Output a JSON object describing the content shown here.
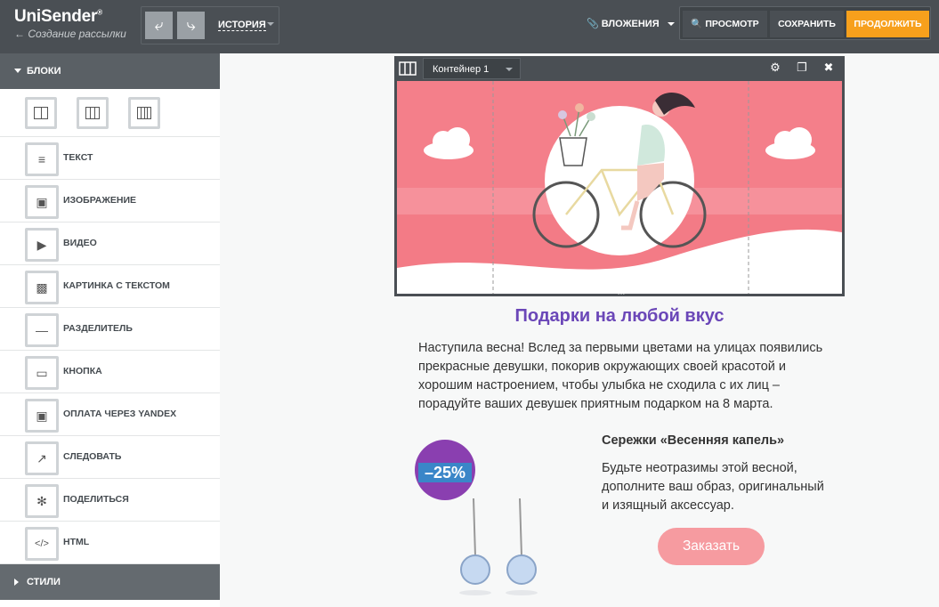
{
  "app": {
    "logo": "UniSender",
    "logo_mark": "®",
    "back_link": "← Создание рассылки"
  },
  "toolbar": {
    "history_label": "ИСТОРИЯ",
    "attachments_label": "ВЛОЖЕНИЯ",
    "preview_label": "ПРОСМОТР",
    "save_label": "СОХРАНИТЬ",
    "continue_label": "ПРОДОЛЖИТЬ"
  },
  "sidebar": {
    "blocks_header": "БЛОКИ",
    "styles_header": "СТИЛИ",
    "column_layouts": [
      2,
      3,
      4
    ],
    "items": [
      {
        "label": "ТЕКСТ",
        "icon": "text-icon"
      },
      {
        "label": "ИЗОБРАЖЕНИЕ",
        "icon": "image-icon"
      },
      {
        "label": "ВИДЕО",
        "icon": "video-icon"
      },
      {
        "label": "КАРТИНКА С ТЕКСТОМ",
        "icon": "image-text-icon"
      },
      {
        "label": "РАЗДЕЛИТЕЛЬ",
        "icon": "divider-icon"
      },
      {
        "label": "КНОПКА",
        "icon": "button-icon"
      },
      {
        "label": "ОПЛАТА ЧЕРЕЗ YANDEX",
        "icon": "wallet-icon"
      },
      {
        "label": "СЛЕДОВАТЬ",
        "icon": "share-icon"
      },
      {
        "label": "ПОДЕЛИТЬСЯ",
        "icon": "twitter-icon"
      },
      {
        "label": "HTML",
        "icon": "code-icon"
      }
    ]
  },
  "container": {
    "select_value": "Контейнер 1"
  },
  "email": {
    "title": "Подарки на любой вкус",
    "intro": "Наступила весна! Вслед за первыми цветами на улицах появились прекрасные девушки, покорив окружающих своей красотой и хорошим настроением, чтобы улыбка не сходила с их лиц – порадуйте ваших девушек приятным подарком на 8 марта.",
    "discount_badge": "–25%",
    "product_title": "Сережки «Весенняя капель»",
    "product_desc": "Будьте неотразимы этой весной, дополните ваш образ, оригинальный и изящный аксессуар.",
    "order_button": "Заказать"
  },
  "colors": {
    "accent": "#f7a01c",
    "title": "#6b47b8",
    "banner_pink": "#f37b86",
    "order_button": "#f69ba0"
  }
}
